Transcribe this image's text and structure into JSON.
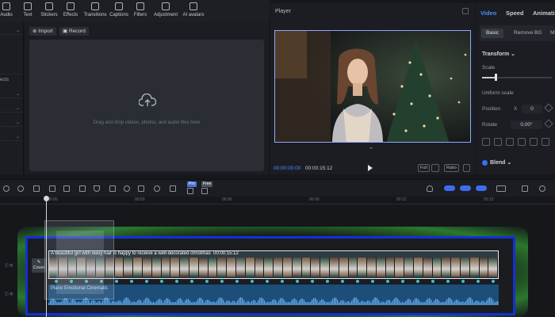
{
  "toolbar": {
    "items": [
      {
        "label": "Audio",
        "icon": "audio-icon"
      },
      {
        "label": "Text",
        "icon": "text-icon"
      },
      {
        "label": "Stickers",
        "icon": "stickers-icon"
      },
      {
        "label": "Effects",
        "icon": "effects-icon"
      },
      {
        "label": "Transitions",
        "icon": "transitions-icon"
      },
      {
        "label": "Captions",
        "icon": "captions-icon"
      },
      {
        "label": "Filters",
        "icon": "filters-icon"
      },
      {
        "label": "Adjustment",
        "icon": "adjustment-icon"
      },
      {
        "label": "AI avatars",
        "icon": "ai-avatars-icon"
      }
    ]
  },
  "leftnav": {
    "label": "ects"
  },
  "media": {
    "import_label": "Import",
    "record_label": "Record",
    "drop_text": "Drag and drop videos, photos, and audio files here"
  },
  "player": {
    "title": "Player",
    "current_time": "00:00:00:00",
    "total_time": "00:00:15:12",
    "full_label": "Full",
    "ratio_label": "Ratio"
  },
  "inspector": {
    "tabs": [
      "Video",
      "Speed",
      "Animation"
    ],
    "subtabs": [
      "Basic",
      "Remove BG",
      "M"
    ],
    "transform_label": "Transform",
    "scale_label": "Scale",
    "uniform_scale_label": "Uniform scale",
    "position_label": "Position",
    "position_x_label": "X",
    "position_x_value": "0",
    "rotate_label": "Rotate",
    "rotate_value": "0.00°",
    "blend_label": "Blend"
  },
  "timeline_toolbar": {
    "badges": [
      "Pro",
      "Free"
    ]
  },
  "timeline": {
    "ruler_ticks": [
      "00:00",
      "00:03",
      "00:06",
      "00:09",
      "00:12",
      "00:15"
    ],
    "cover_label": "Cover",
    "clip_title": "A beautiful girl with wavy hair is happy to receive a well-decorated christmas",
    "clip_duration": "00:00:15:12",
    "audio_label": "Piano Emotional Cinematic"
  },
  "colors": {
    "accent": "#3c6df0",
    "highlight_frame": "#1230d8",
    "highlight_glow": "#3cc83c",
    "audio_track": "#1d4d79",
    "keyframe_dot": "#36c1d0"
  }
}
